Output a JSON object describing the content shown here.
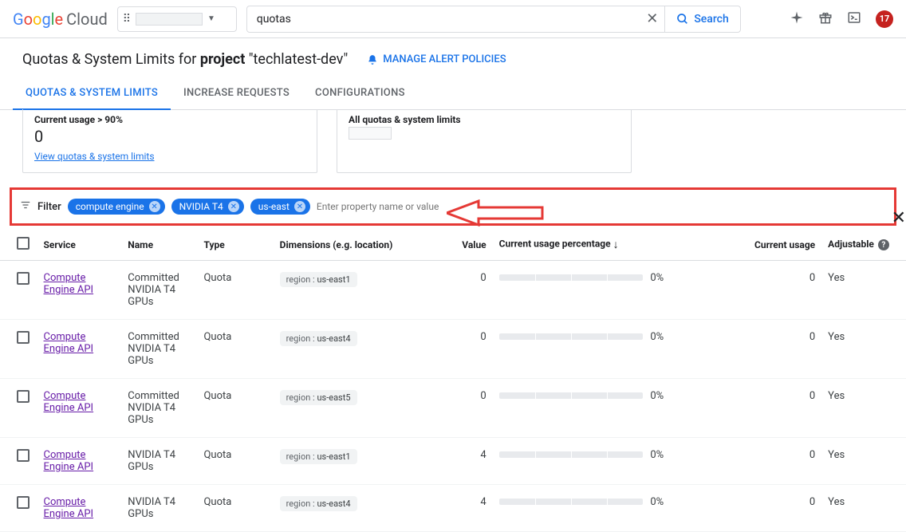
{
  "header": {
    "logo_prefix": "Google",
    "logo_suffix": "Cloud",
    "search_value": "quotas",
    "search_button": "Search",
    "notif_count": "17"
  },
  "page": {
    "title_prefix": "Quotas & System Limits for ",
    "title_project_word": "project",
    "title_suffix": " \"techlatest-dev\"",
    "alert_link": "MANAGE ALERT POLICIES"
  },
  "tabs": {
    "t1": "QUOTAS & SYSTEM LIMITS",
    "t2": "INCREASE REQUESTS",
    "t3": "CONFIGURATIONS"
  },
  "cards": {
    "c1_title": "Current usage > 90%",
    "c1_value": "0",
    "c1_link": "View quotas & system limits",
    "c2_title": "All quotas & system limits"
  },
  "filter": {
    "label": "Filter",
    "chips": [
      "compute engine",
      "NVIDIA T4",
      "us-east"
    ],
    "placeholder": "Enter property name or value"
  },
  "columns": {
    "service": "Service",
    "name": "Name",
    "type": "Type",
    "dimensions": "Dimensions (e.g. location)",
    "value": "Value",
    "pct": "Current usage percentage",
    "usage": "Current usage",
    "adjustable": "Adjustable"
  },
  "rows": [
    {
      "service": "Compute Engine API",
      "name": "Committed NVIDIA T4 GPUs",
      "type": "Quota",
      "dim_key": "region",
      "dim_val": "us-east1",
      "value": "0",
      "pct": "0%",
      "usage": "0",
      "adjustable": "Yes"
    },
    {
      "service": "Compute Engine API",
      "name": "Committed NVIDIA T4 GPUs",
      "type": "Quota",
      "dim_key": "region",
      "dim_val": "us-east4",
      "value": "0",
      "pct": "0%",
      "usage": "0",
      "adjustable": "Yes"
    },
    {
      "service": "Compute Engine API",
      "name": "Committed NVIDIA T4 GPUs",
      "type": "Quota",
      "dim_key": "region",
      "dim_val": "us-east5",
      "value": "0",
      "pct": "0%",
      "usage": "0",
      "adjustable": "Yes"
    },
    {
      "service": "Compute Engine API",
      "name": "NVIDIA T4 GPUs",
      "type": "Quota",
      "dim_key": "region",
      "dim_val": "us-east1",
      "value": "4",
      "pct": "0%",
      "usage": "0",
      "adjustable": "Yes"
    },
    {
      "service": "Compute Engine API",
      "name": "NVIDIA T4 GPUs",
      "type": "Quota",
      "dim_key": "region",
      "dim_val": "us-east4",
      "value": "4",
      "pct": "0%",
      "usage": "0",
      "adjustable": "Yes"
    }
  ]
}
